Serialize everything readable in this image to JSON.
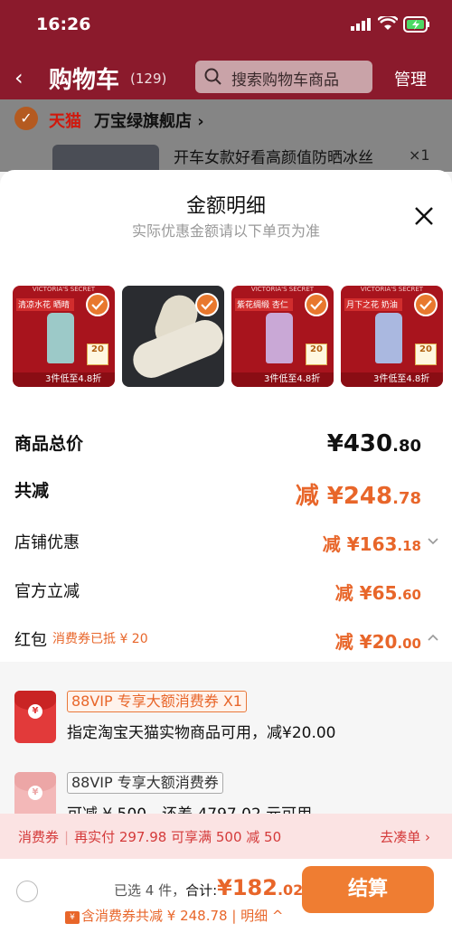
{
  "status_bar": {
    "time": "16:26"
  },
  "nav": {
    "title": "购物车",
    "count": "(129)",
    "search_placeholder": "搜索购物车商品",
    "manage": "管理"
  },
  "shop": {
    "tmall_label": "天猫",
    "shop_name": "万宝绿旗舰店 ›",
    "item_title": "开车女款好看高颜值防晒冰丝",
    "item_qty": "×1"
  },
  "sheet": {
    "title": "金额明细",
    "subtitle": "实际优惠金额请以下单页为准",
    "thumbnails": [
      {
        "name": "清凉水花 晒晴",
        "deal": "3件低至4.8折",
        "box": "20",
        "bottle_color": "#9cc9c8"
      },
      {
        "name": "",
        "deal": "",
        "box": "",
        "bottle_color": ""
      },
      {
        "name": "紫花绸缎 杏仁",
        "deal": "3件低至4.8折",
        "box": "20",
        "bottle_color": "#c9a8d6"
      },
      {
        "name": "月下之花 奶油",
        "deal": "3件低至4.8折",
        "box": "20",
        "bottle_color": "#aab8e0"
      }
    ],
    "rows": {
      "total": {
        "label": "商品总价",
        "int": "¥430",
        "dec": ".80"
      },
      "reduce": {
        "label": "共减",
        "int": "减 ¥248",
        "dec": ".78"
      },
      "shop_discount": {
        "label": "店铺优惠",
        "int": "减 ¥163",
        "dec": ".18"
      },
      "official": {
        "label": "官方立减",
        "int": "减 ¥65",
        "dec": ".60"
      },
      "redpacket": {
        "label": "红包",
        "tag": "消费券已抵 ¥ 20",
        "int": "减 ¥20",
        "dec": ".00"
      }
    },
    "coupons": [
      {
        "tag": "88VIP 专享大额消费券 X1",
        "desc": "指定淘宝天猫实物商品可用，减¥20.00"
      },
      {
        "tag": "88VIP 专享大额消费券",
        "desc": "可减 ¥ 500，还差 4797.02 元可用"
      }
    ]
  },
  "promo": {
    "label": "消费券",
    "text": "再实付 297.98 可享满 500 减 50",
    "action": "去凑单 ›"
  },
  "bottom": {
    "selected": "已选 4 件，",
    "heji": "合计:",
    "total_int": "¥182",
    "total_dec": ".02",
    "discount_line": "含消费券共减 ¥ 248.78 | 明细 ^",
    "checkout": "结算"
  },
  "colors": {
    "accent": "#e8662a",
    "header": "#8b1a2c",
    "promo_bg": "#fbe3e3"
  }
}
